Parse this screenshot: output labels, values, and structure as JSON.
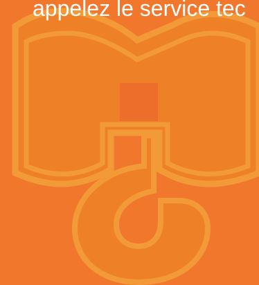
{
  "message": {
    "text": "appelez le service tec"
  },
  "colors": {
    "background": "#F1772C",
    "emblem_fill": "#EE8127",
    "emblem_outline": "#F39A38",
    "emblem_square": "#EC6E2A",
    "text": "#FFFFFF"
  },
  "emblem": {
    "icon": "shield-with-crane-hook-icon"
  }
}
